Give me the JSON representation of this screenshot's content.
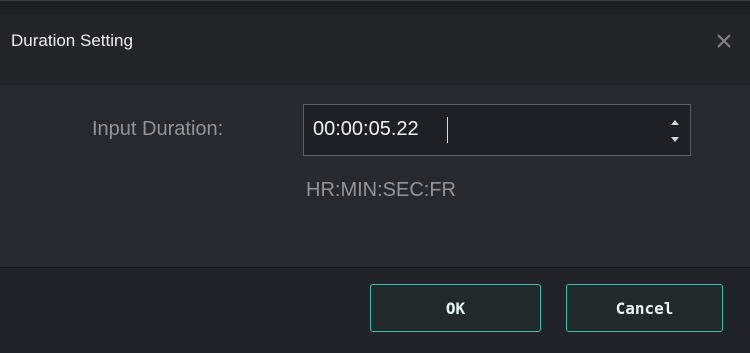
{
  "dialog": {
    "title": "Duration Setting",
    "close_icon": "close-icon"
  },
  "form": {
    "label": "Input Duration:",
    "value": "00:00:05.22",
    "hint": "HR:MIN:SEC:FR",
    "spinner_icon": "spinner-arrows-icon"
  },
  "buttons": {
    "ok_label": "OK",
    "cancel_label": "Cancel"
  },
  "colors": {
    "accent": "#37c1ad",
    "background": "#242629"
  }
}
